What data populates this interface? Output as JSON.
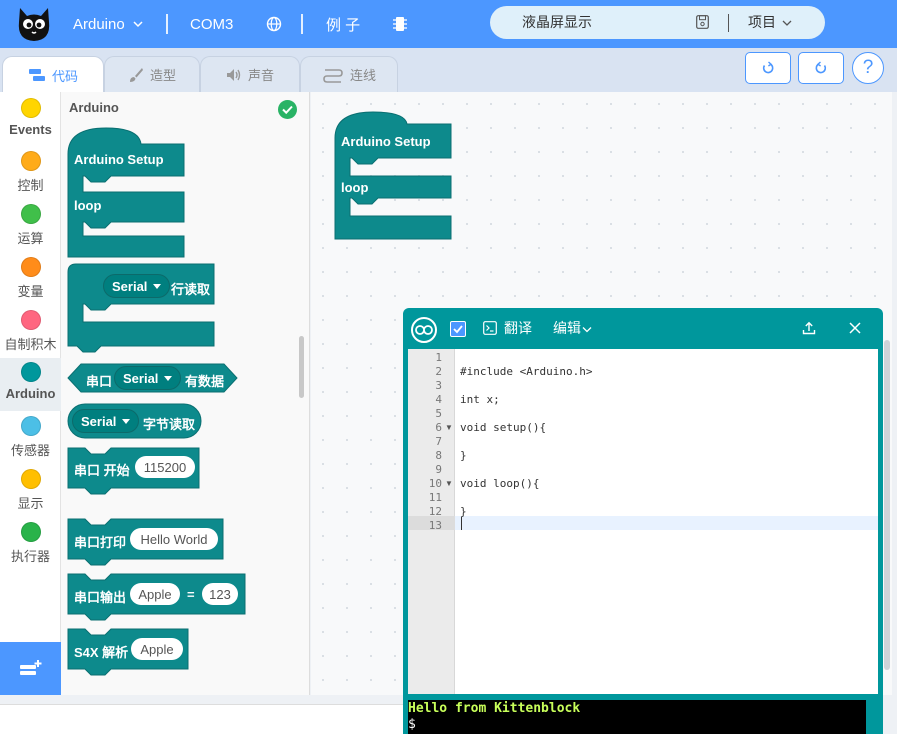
{
  "topbar": {
    "board": "Arduino",
    "port": "COM3",
    "examples": "例 子",
    "project_name": "液晶屏显示",
    "project_menu": "项目"
  },
  "tabs": {
    "code": "代码",
    "costume": "造型",
    "sound": "声音",
    "wiring": "连线"
  },
  "help_label": "?",
  "categories": [
    {
      "label": "Events",
      "color": "#ffd500"
    },
    {
      "label": "控制",
      "color": "#ffab19"
    },
    {
      "label": "运算",
      "color": "#40bf4a"
    },
    {
      "label": "变量",
      "color": "#ff8c1a"
    },
    {
      "label": "自制积木",
      "color": "#ff6680"
    },
    {
      "label": "Arduino",
      "color": "#00979c"
    },
    {
      "label": "传感器",
      "color": "#4cbfe6"
    },
    {
      "label": "显示",
      "color": "#ffbf00"
    },
    {
      "label": "执行器",
      "color": "#29b34a"
    }
  ],
  "palette": {
    "title": "Arduino",
    "block_color": "#0d8a8c",
    "blocks": {
      "setup": "Arduino Setup",
      "loop": "loop",
      "serial_dd": "Serial",
      "read_line": "行读取",
      "serial_port": "串口",
      "has_data": "有数据",
      "byte_read": "字节读取",
      "serial_begin": "串口 开始",
      "baud": "115200",
      "serial_print": "串口打印",
      "print_value": "Hello World",
      "serial_output": "串口输出",
      "output_key": "Apple",
      "equals": "=",
      "output_value": "123",
      "s4x_parse": "S4X 解析",
      "s4x_value": "Apple"
    }
  },
  "workspace": {
    "setup": "Arduino Setup",
    "loop": "loop"
  },
  "panel": {
    "translate": "翻译",
    "edit": "编辑",
    "code_lines": [
      {
        "n": "1",
        "text": ""
      },
      {
        "n": "2",
        "text": "#include <Arduino.h>"
      },
      {
        "n": "3",
        "text": ""
      },
      {
        "n": "4",
        "text": "int x;"
      },
      {
        "n": "5",
        "text": ""
      },
      {
        "n": "6",
        "text": "void setup(){"
      },
      {
        "n": "7",
        "text": ""
      },
      {
        "n": "8",
        "text": "}"
      },
      {
        "n": "9",
        "text": ""
      },
      {
        "n": "10",
        "text": "void loop(){"
      },
      {
        "n": "11",
        "text": ""
      },
      {
        "n": "12",
        "text": "}"
      },
      {
        "n": "13",
        "text": ""
      }
    ],
    "console_line1": "Hello from Kittenblock",
    "console_line2": "$",
    "console_color": "#c8ff5a"
  }
}
